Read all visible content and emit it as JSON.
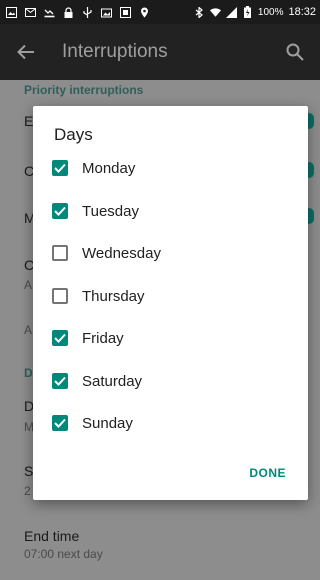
{
  "status_bar": {
    "battery": "100%",
    "time": "18:32"
  },
  "app_bar": {
    "title": "Interruptions"
  },
  "background": {
    "priority_header": "Priority interruptions",
    "row1_letter": "E",
    "row2_letter": "C",
    "row3_letter": "M",
    "row4_letter": "C",
    "row4_sub": "A",
    "row5_sub": "A",
    "downtime_header": "D",
    "days_letter": "D",
    "days_sub": "M",
    "start_letter": "S",
    "start_sub": "2",
    "end_time_title": "End time",
    "end_time_sub": "07:00 next day"
  },
  "dialog": {
    "title": "Days",
    "days": [
      {
        "label": "Monday",
        "checked": true
      },
      {
        "label": "Tuesday",
        "checked": true
      },
      {
        "label": "Wednesday",
        "checked": false
      },
      {
        "label": "Thursday",
        "checked": false
      },
      {
        "label": "Friday",
        "checked": true
      },
      {
        "label": "Saturday",
        "checked": true
      },
      {
        "label": "Sunday",
        "checked": true
      }
    ],
    "done_label": "DONE"
  }
}
